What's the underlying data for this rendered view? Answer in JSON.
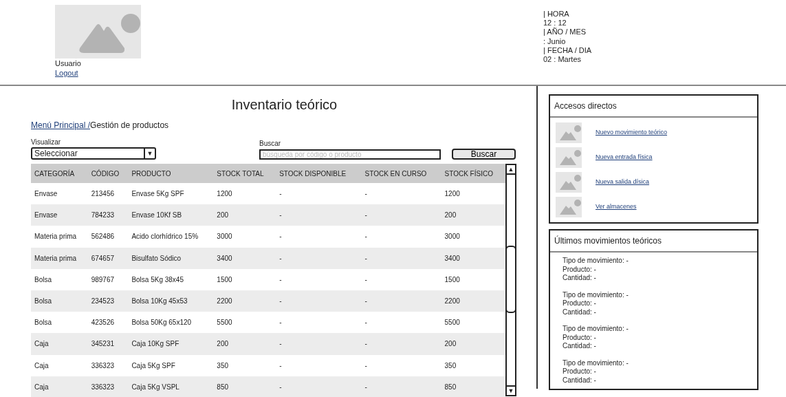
{
  "header": {
    "user": "Usuario",
    "logout": "Logout",
    "clock": [
      "| HORA",
      "12 : 12",
      "| AÑO / MES",
      ": Junio",
      "| FECHA / DIA",
      "02 : Martes"
    ]
  },
  "title": "Inventario teórico",
  "breadcrumb": {
    "link": "Menú Principal /",
    "current": "Gestión de productos"
  },
  "filter": {
    "label": "Visualizar",
    "value": "Seleccionar",
    "arrow": "▼"
  },
  "search": {
    "label": "Buscar",
    "placeholder": "búsqueda por código o producto",
    "button": "Buscar"
  },
  "table": {
    "columns": [
      "CATEGORÍA",
      "CÓDIGO",
      "PRODUCTO",
      "STOCK TOTAL",
      "STOCK DISPONIBLE",
      "STOCK EN CURSO",
      "STOCK FÍSICO"
    ],
    "rows": [
      [
        "Envase",
        "213456",
        "Envase 5Kg SPF",
        "1200",
        "-",
        "-",
        "1200"
      ],
      [
        "Envase",
        "784233",
        "Envase 10Kf SB",
        "200",
        "-",
        "-",
        "200"
      ],
      [
        "Materia prima",
        "562486",
        "Acido clorhídrico 15%",
        "3000",
        "-",
        "-",
        "3000"
      ],
      [
        "Materia prima",
        "674657",
        "Bisulfato Sódico",
        "3400",
        "-",
        "-",
        "3400"
      ],
      [
        "Bolsa",
        "989767",
        "Bolsa 5Kg 38x45",
        "1500",
        "-",
        "-",
        "1500"
      ],
      [
        "Bolsa",
        "234523",
        "Bolsa 10Kg 45x53",
        "2200",
        "-",
        "-",
        "2200"
      ],
      [
        "Bolsa",
        "423526",
        "Bolsa 50Kg 65x120",
        "5500",
        "-",
        "-",
        "5500"
      ],
      [
        "Caja",
        "345231",
        "Caja 10Kg SPF",
        "200",
        "-",
        "-",
        "200"
      ],
      [
        "Caja",
        "336323",
        "Caja 5Kg SPF",
        "350",
        "-",
        "-",
        "350"
      ],
      [
        "Caja",
        "336323",
        "Caja 5Kg VSPL",
        "850",
        "-",
        "-",
        "850"
      ]
    ],
    "scroll_up": "▲",
    "scroll_down": "▼"
  },
  "shortcuts": {
    "title": "Accesos directos",
    "items": [
      "Nuevo movimiento teórico",
      "Nueva entrada física",
      "Nueva salida dísica",
      "Ver almacenes"
    ]
  },
  "movements": {
    "title": "Últimos movimientos teóricos",
    "items": [
      {
        "type": "Tipo de movimiento: -",
        "product": "Producto: -",
        "quantity": "Cantidad: -"
      },
      {
        "type": "Tipo de movimiento: -",
        "product": "Producto: -",
        "quantity": "Cantidad: -"
      },
      {
        "type": "Tipo de movimiento: -",
        "product": "Producto: -",
        "quantity": "Cantidad: -"
      },
      {
        "type": "Tipo de movimiento: -",
        "product": "Producto: -",
        "quantity": "Cantidad: -"
      }
    ]
  }
}
